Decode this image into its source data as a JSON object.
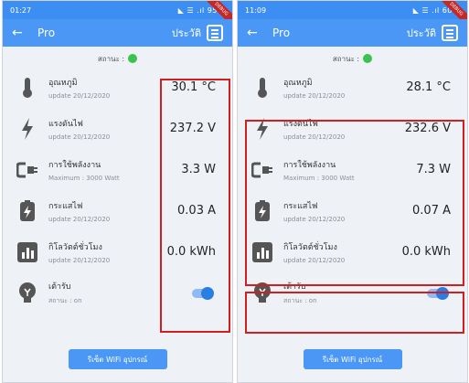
{
  "left": {
    "statusbar": {
      "time": "01:27",
      "right": "◣ ☰ .ıl 95%"
    },
    "appbar": {
      "title": "Pro",
      "history": "ประวัติ"
    },
    "status_label": "สถานะ :",
    "items": [
      {
        "name": "อุณหภูมิ",
        "sub": "update 20/12/2020",
        "value": "30.1  °C"
      },
      {
        "name": "แรงดันไฟ",
        "sub": "update 20/12/2020",
        "value": "237.2  V"
      },
      {
        "name": "การใช้พลังงาน",
        "sub": "Maximum : 3000 Watt",
        "value": "3.3  W"
      },
      {
        "name": "กระแสไฟ",
        "sub": "update 20/12/2020",
        "value": "0.03  A"
      },
      {
        "name": "กิโลวัตต์ชั่วโมง",
        "sub": "update 20/12/2020",
        "value": "0.0  kWh"
      }
    ],
    "socket": {
      "name": "เต้ารับ",
      "sub": "สถานะ : on"
    },
    "reset_button": "รีเซ็ต WiFi อุปกรณ์"
  },
  "right": {
    "statusbar": {
      "time": "11:09",
      "right": "◣ ☰ .ıl 60%"
    },
    "appbar": {
      "title": "Pro",
      "history": "ประวัติ"
    },
    "status_label": "สถานะ :",
    "items": [
      {
        "name": "อุณหภูมิ",
        "sub": "update 20/12/2020",
        "value": "28.1  °C"
      },
      {
        "name": "แรงดันไฟ",
        "sub": "update 20/12/2020",
        "value": "232.6  V"
      },
      {
        "name": "การใช้พลังงาน",
        "sub": "Maximum : 3000 Watt",
        "value": "7.3  W"
      },
      {
        "name": "กระแสไฟ",
        "sub": "update 20/12/2020",
        "value": "0.07  A"
      },
      {
        "name": "กิโลวัตต์ชั่วโมง",
        "sub": "update 20/12/2020",
        "value": "0.0  kWh"
      }
    ],
    "socket": {
      "name": "เต้ารับ",
      "sub": "สถานะ : on"
    },
    "reset_button": "รีเซ็ต WiFi อุปกรณ์"
  },
  "icons": [
    "thermometer-icon",
    "lightning-icon",
    "power-plug-icon",
    "battery-charging-icon",
    "bar-chart-icon",
    "lightbulb-icon",
    "history-list-icon",
    "back-arrow-icon"
  ],
  "colors": {
    "app_bar": "#4a97f5",
    "status_on": "#3cc24f",
    "toggle_on": "#2a7de1",
    "highlight": "#d11f1f"
  }
}
